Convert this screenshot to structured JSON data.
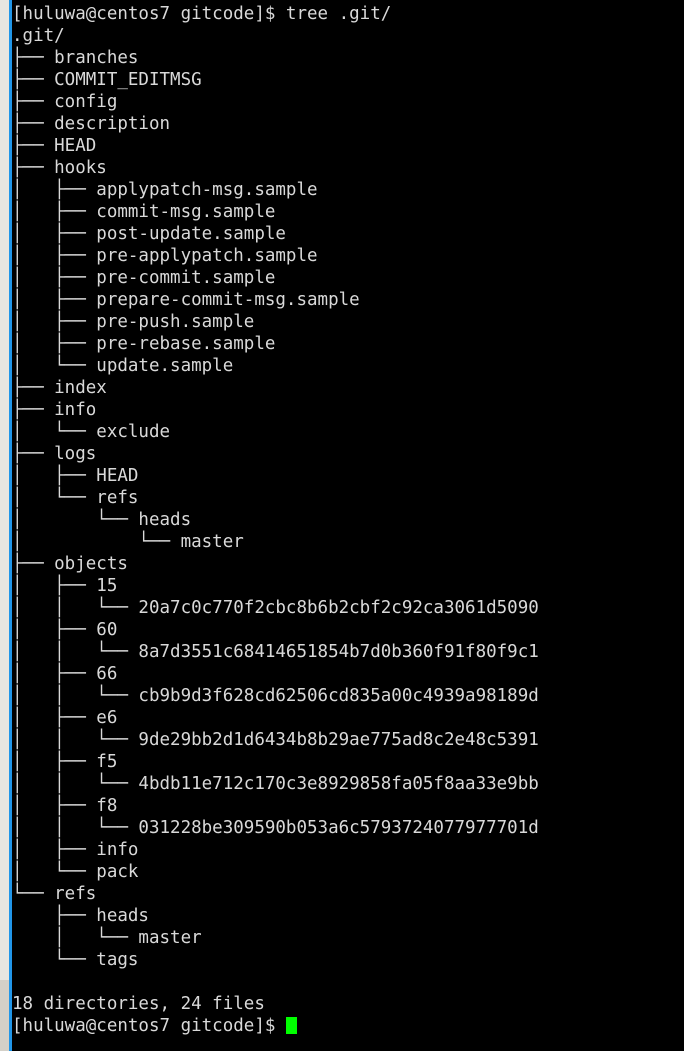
{
  "terminal": {
    "title": "terminal",
    "colors": {
      "background": "#000000",
      "foreground": "#d9d9d9",
      "cursor": "#00ff00",
      "gutter_track": "#d4d0c8",
      "gutter_thumb": "#e8e6e1",
      "gutter_accent": "#2196e8"
    },
    "prompt_top": "[huluwa@centos7 gitcode]$ tree .git/",
    "prompt_bottom": "[huluwa@centos7 gitcode]$ ",
    "summary": "18 directories, 24 files",
    "cursor_glyph": "block-cursor",
    "lines": [
      "[huluwa@centos7 gitcode]$ tree .git/",
      ".git/",
      "├── branches",
      "├── COMMIT_EDITMSG",
      "├── config",
      "├── description",
      "├── HEAD",
      "├── hooks",
      "│   ├── applypatch-msg.sample",
      "│   ├── commit-msg.sample",
      "│   ├── post-update.sample",
      "│   ├── pre-applypatch.sample",
      "│   ├── pre-commit.sample",
      "│   ├── prepare-commit-msg.sample",
      "│   ├── pre-push.sample",
      "│   ├── pre-rebase.sample",
      "│   └── update.sample",
      "├── index",
      "├── info",
      "│   └── exclude",
      "├── logs",
      "│   ├── HEAD",
      "│   └── refs",
      "│       └── heads",
      "│           └── master",
      "├── objects",
      "│   ├── 15",
      "│   │   └── 20a7c0c770f2cbc8b6b2cbf2c92ca3061d5090",
      "│   ├── 60",
      "│   │   └── 8a7d3551c68414651854b7d0b360f91f80f9c1",
      "│   ├── 66",
      "│   │   └── cb9b9d3f628cd62506cd835a00c4939a98189d",
      "│   ├── e6",
      "│   │   └── 9de29bb2d1d6434b8b29ae775ad8c2e48c5391",
      "│   ├── f5",
      "│   │   └── 4bdb11e712c170c3e8929858fa05f8aa33e9bb",
      "│   ├── f8",
      "│   │   └── 031228be309590b053a6c5793724077977701d",
      "│   ├── info",
      "│   └── pack",
      "└── refs",
      "    ├── heads",
      "    │   └── master",
      "    └── tags",
      "",
      "18 directories, 24 files"
    ]
  }
}
